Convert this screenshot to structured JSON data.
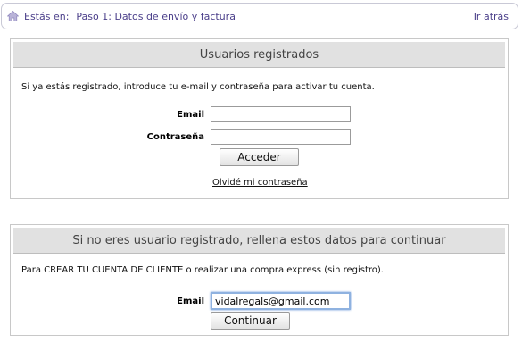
{
  "breadcrumb": {
    "prefix": "Estás en:",
    "current": "Paso 1: Datos de envío y factura",
    "back_label": "Ir atrás"
  },
  "login_panel": {
    "title": "Usuarios registrados",
    "intro": "Si ya estás registrado, introduce tu e-mail y contraseña para activar tu cuenta.",
    "email_label": "Email",
    "email_value": "",
    "password_label": "Contraseña",
    "password_value": "",
    "submit_label": "Acceder",
    "forgot_label": "Olvidé mi contraseña"
  },
  "register_panel": {
    "title": "Si no eres usuario registrado, rellena estos datos para continuar",
    "intro": "Para CREAR TU CUENTA DE CLIENTE o realizar una compra express (sin registro).",
    "email_label": "Email",
    "email_value": "vidalregals@gmail.com",
    "submit_label": "Continuar"
  },
  "colors": {
    "breadcrumb_text": "#4b3f8a",
    "panel_header_bg": "#e1e1e1",
    "focus_ring": "#8fb2e0"
  }
}
